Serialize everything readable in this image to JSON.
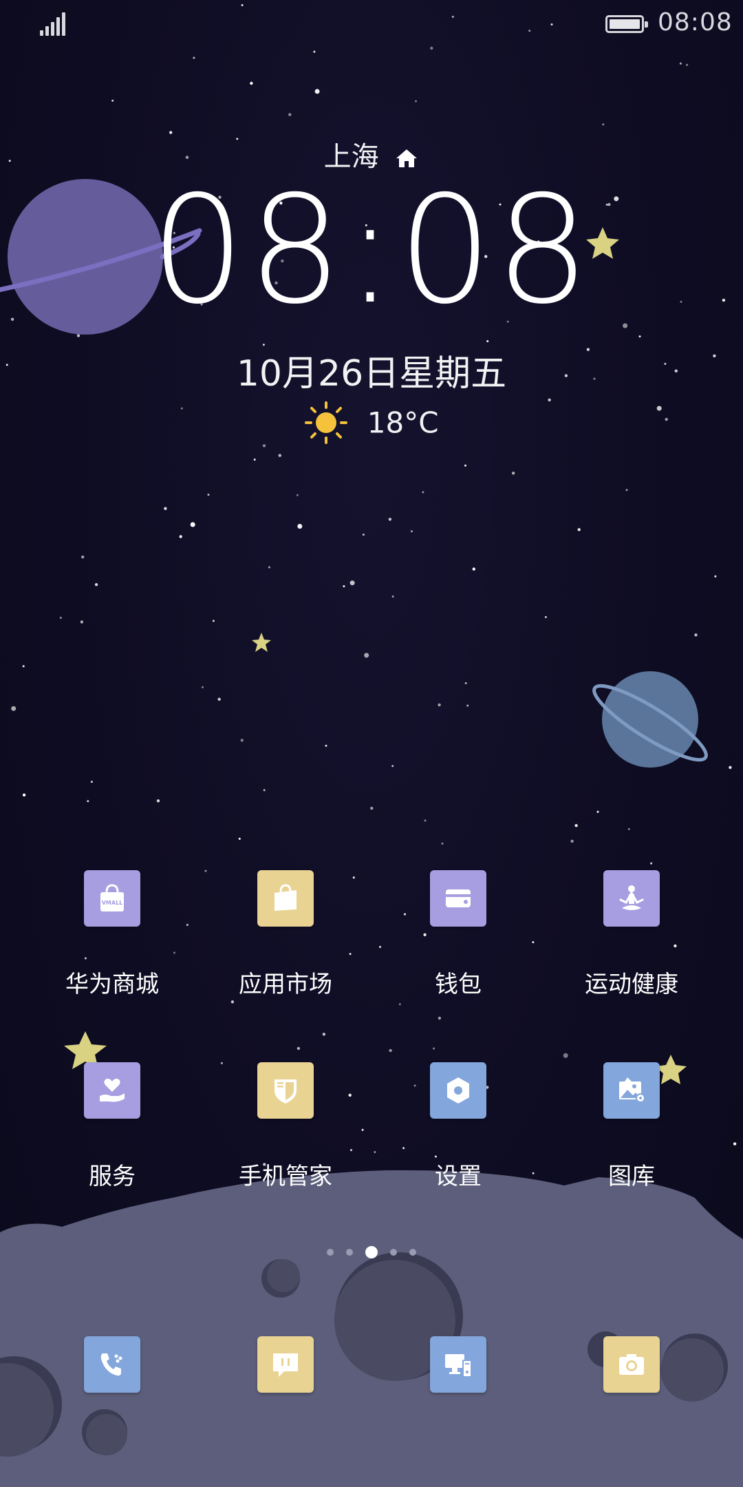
{
  "status_bar": {
    "time": "08:08",
    "signal_icon": "signal-bars-icon",
    "battery_icon": "battery-full-icon"
  },
  "clock_widget": {
    "city": "上海",
    "time": "08:08",
    "date": "10月26日星期五",
    "temperature": "18°C",
    "weather_icon": "sunny-icon"
  },
  "apps": [
    {
      "label": "华为商城",
      "icon": "vmall-bag-icon",
      "color": "#a69ee0"
    },
    {
      "label": "应用市场",
      "icon": "app-market-bag-icon",
      "color": "#e8d393"
    },
    {
      "label": "钱包",
      "icon": "wallet-icon",
      "color": "#a69ee0"
    },
    {
      "label": "运动健康",
      "icon": "meditation-icon",
      "color": "#a69ee0"
    },
    {
      "label": "服务",
      "icon": "heart-hand-icon",
      "color": "#a69ee0"
    },
    {
      "label": "手机管家",
      "icon": "shield-icon",
      "color": "#e8d393"
    },
    {
      "label": "设置",
      "icon": "settings-hex-icon",
      "color": "#83a6dc"
    },
    {
      "label": "图库",
      "icon": "gallery-icon",
      "color": "#83a6dc"
    }
  ],
  "page_indicator": {
    "count": 5,
    "active_index": 2
  },
  "dock": [
    {
      "icon": "phone-icon",
      "color": "#83a6dc"
    },
    {
      "icon": "messages-icon",
      "color": "#e8d393"
    },
    {
      "icon": "computer-icon",
      "color": "#83a6dc"
    },
    {
      "icon": "camera-icon",
      "color": "#e8d393"
    }
  ]
}
